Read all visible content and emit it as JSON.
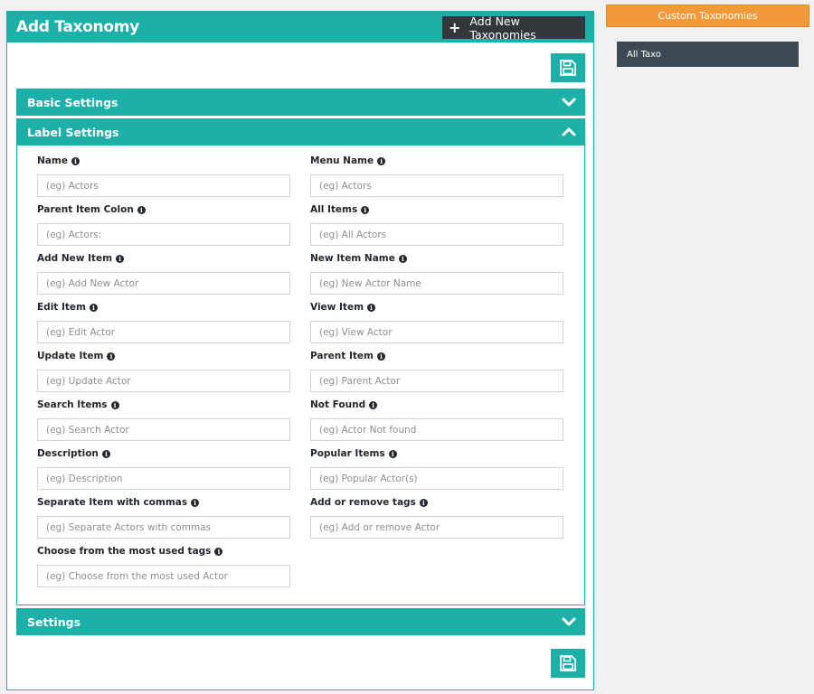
{
  "header": {
    "title": "Add Taxonomy",
    "add_new_label": "Add New Taxonomies"
  },
  "sections": {
    "basic": "Basic Settings",
    "label": "Label Settings",
    "settings": "Settings"
  },
  "fields": [
    {
      "label": "Name",
      "placeholder": "(eg) Actors"
    },
    {
      "label": "Menu Name",
      "placeholder": "(eg) Actors"
    },
    {
      "label": "Parent Item Colon",
      "placeholder": "(eg) Actors:"
    },
    {
      "label": "All Items",
      "placeholder": "(eg) All Actors"
    },
    {
      "label": "Add New Item",
      "placeholder": "(eg) Add New Actor"
    },
    {
      "label": "New Item Name",
      "placeholder": "(eg) New Actor Name"
    },
    {
      "label": "Edit Item",
      "placeholder": "(eg) Edit Actor"
    },
    {
      "label": "View Item",
      "placeholder": "(eg) View Actor"
    },
    {
      "label": "Update Item",
      "placeholder": "(eg) Update Actor"
    },
    {
      "label": "Parent Item",
      "placeholder": "(eg) Parent Actor"
    },
    {
      "label": "Search Items",
      "placeholder": "(eg) Search Actor"
    },
    {
      "label": "Not Found",
      "placeholder": "(eg) Actor Not found"
    },
    {
      "label": "Description",
      "placeholder": "(eg) Description"
    },
    {
      "label": "Popular Items",
      "placeholder": "(eg) Popular Actor(s)"
    },
    {
      "label": "Separate Item with commas",
      "placeholder": "(eg) Separate Actors with commas"
    },
    {
      "label": "Add or remove tags",
      "placeholder": "(eg) Add or remove Actor"
    },
    {
      "label": "Choose from the most used tags",
      "placeholder": "(eg) Choose from the most used Actor"
    }
  ],
  "sidebar": {
    "button_label": "Custom Taxonomies",
    "items": [
      {
        "label": "All Taxo"
      }
    ]
  },
  "colors": {
    "accent": "#1cb0a8",
    "dark_button": "#32373c",
    "sidebar_button": "#f29a3a",
    "sidebar_item": "#3a4954"
  },
  "icons": {
    "add": "plus-icon",
    "save": "floppy-disk-icon",
    "collapse": "chevron-down-icon",
    "expand": "chevron-up-icon",
    "info": "info-icon"
  }
}
